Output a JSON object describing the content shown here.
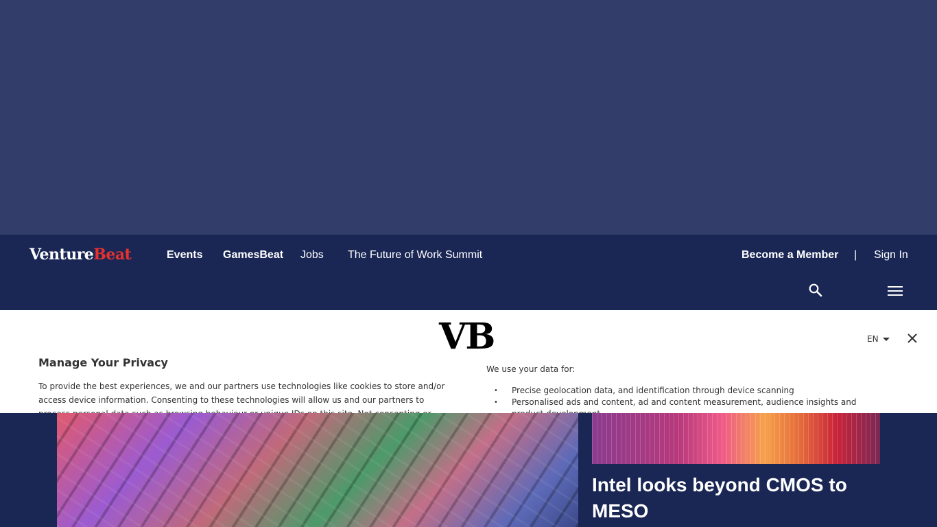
{
  "site": {
    "logo_venture": "Venture",
    "logo_beat": "Beat"
  },
  "nav": {
    "links": [
      {
        "label": "Events"
      },
      {
        "label": "GamesBeat"
      },
      {
        "label": "Jobs"
      },
      {
        "label": "The Future of Work Summit"
      }
    ],
    "member_label": "Become a Member",
    "separator": "|",
    "signin_label": "Sign In",
    "icons": {
      "search": "search-icon",
      "menu": "hamburger-menu-icon"
    }
  },
  "privacy": {
    "logo": "VB",
    "language": "EN",
    "title": "Manage Your Privacy",
    "body": "To provide the best experiences, we and our partners use technologies like cookies to store and/or access device information. Consenting to these technologies will allow us and our partners to process personal data such as browsing behaviour or unique IDs on this site. Not consenting or",
    "use_title": "We use your data for:",
    "uses": [
      "Precise geolocation data, and identification through device scanning",
      "Personalised ads and content, ad and content measurement, audience insights and product development"
    ]
  },
  "content": {
    "side_headline": "Intel looks beyond CMOS to MESO"
  },
  "colors": {
    "background": "#323e69",
    "navbar": "#1a2755",
    "brand_accent": "#e6322d",
    "modal_bg": "#ffffff"
  }
}
